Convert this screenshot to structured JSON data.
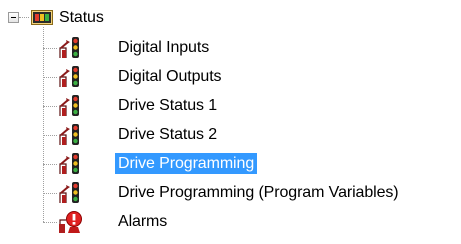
{
  "tree": {
    "root": {
      "label": "Status",
      "icon": "status-folder-icon",
      "expanded": true
    },
    "items": [
      {
        "label": "Digital Inputs",
        "icon": "signal-light-icon",
        "selected": false
      },
      {
        "label": "Digital Outputs",
        "icon": "signal-light-icon",
        "selected": false
      },
      {
        "label": "Drive Status 1",
        "icon": "signal-light-icon",
        "selected": false
      },
      {
        "label": "Drive Status 2",
        "icon": "signal-light-icon",
        "selected": false
      },
      {
        "label": "Drive Programming",
        "icon": "signal-light-icon",
        "selected": true
      },
      {
        "label": "Drive Programming (Program Variables)",
        "icon": "signal-light-icon",
        "selected": false
      },
      {
        "label": "Alarms",
        "icon": "alarm-icon",
        "selected": false
      }
    ],
    "colors": {
      "selection": "#3399ff",
      "selection_text": "#ffffff",
      "connector": "#a0a0a0"
    }
  }
}
